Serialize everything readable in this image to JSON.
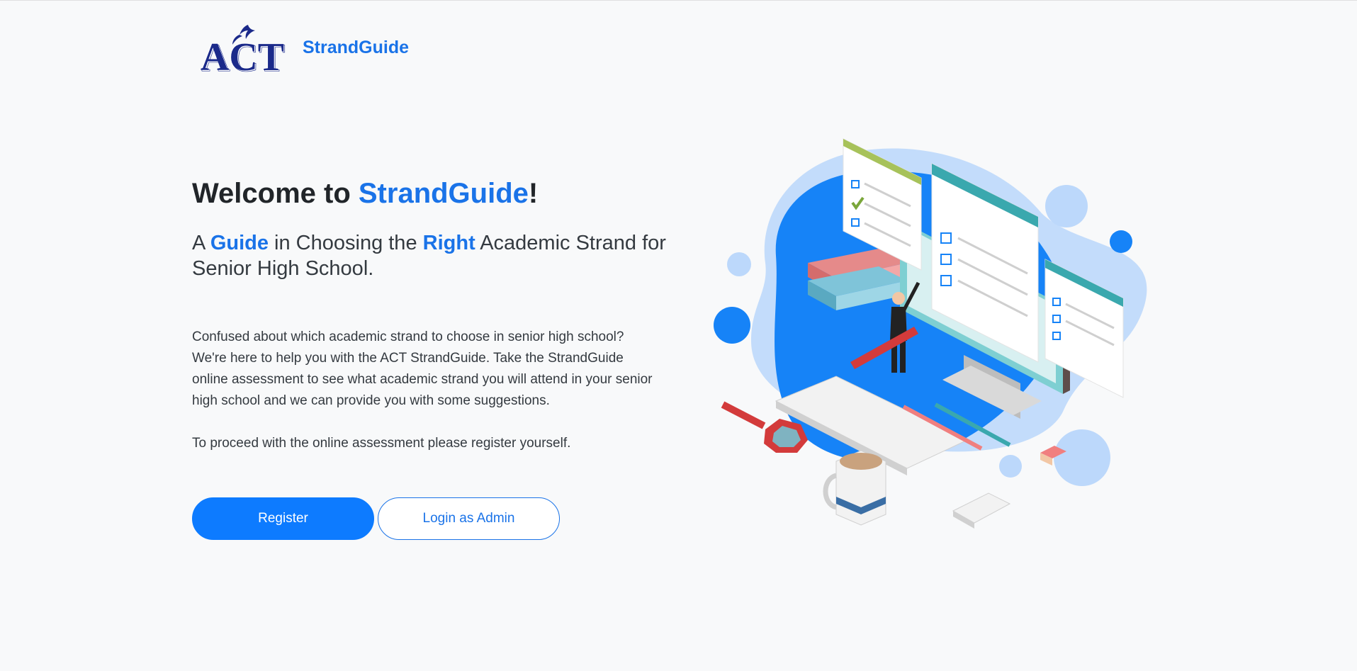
{
  "header": {
    "logo_text": "ACT",
    "brand": "StrandGuide"
  },
  "hero": {
    "title_prefix": "Welcome to ",
    "title_brand": "StrandGuide",
    "title_suffix": "!",
    "subtitle": {
      "part1": "A ",
      "guide": "Guide",
      "part2": " in Choosing the ",
      "right": "Right",
      "part3": " Academic Strand for Senior High School."
    },
    "description": "Confused about which academic strand to choose in senior high school? We're here to help you with the ACT StrandGuide. Take the StrandGuide online assessment to see what academic strand you will attend in your senior high school and we can provide you with some suggestions.",
    "instruction": "To proceed with the online assessment please register yourself."
  },
  "buttons": {
    "register": "Register",
    "login_admin": "Login as Admin"
  },
  "colors": {
    "accent": "#1a73e8",
    "primary_button": "#0d7bff",
    "background": "#f8f9fa"
  },
  "illustration": {
    "name": "online-assessment-isometric-illustration"
  }
}
